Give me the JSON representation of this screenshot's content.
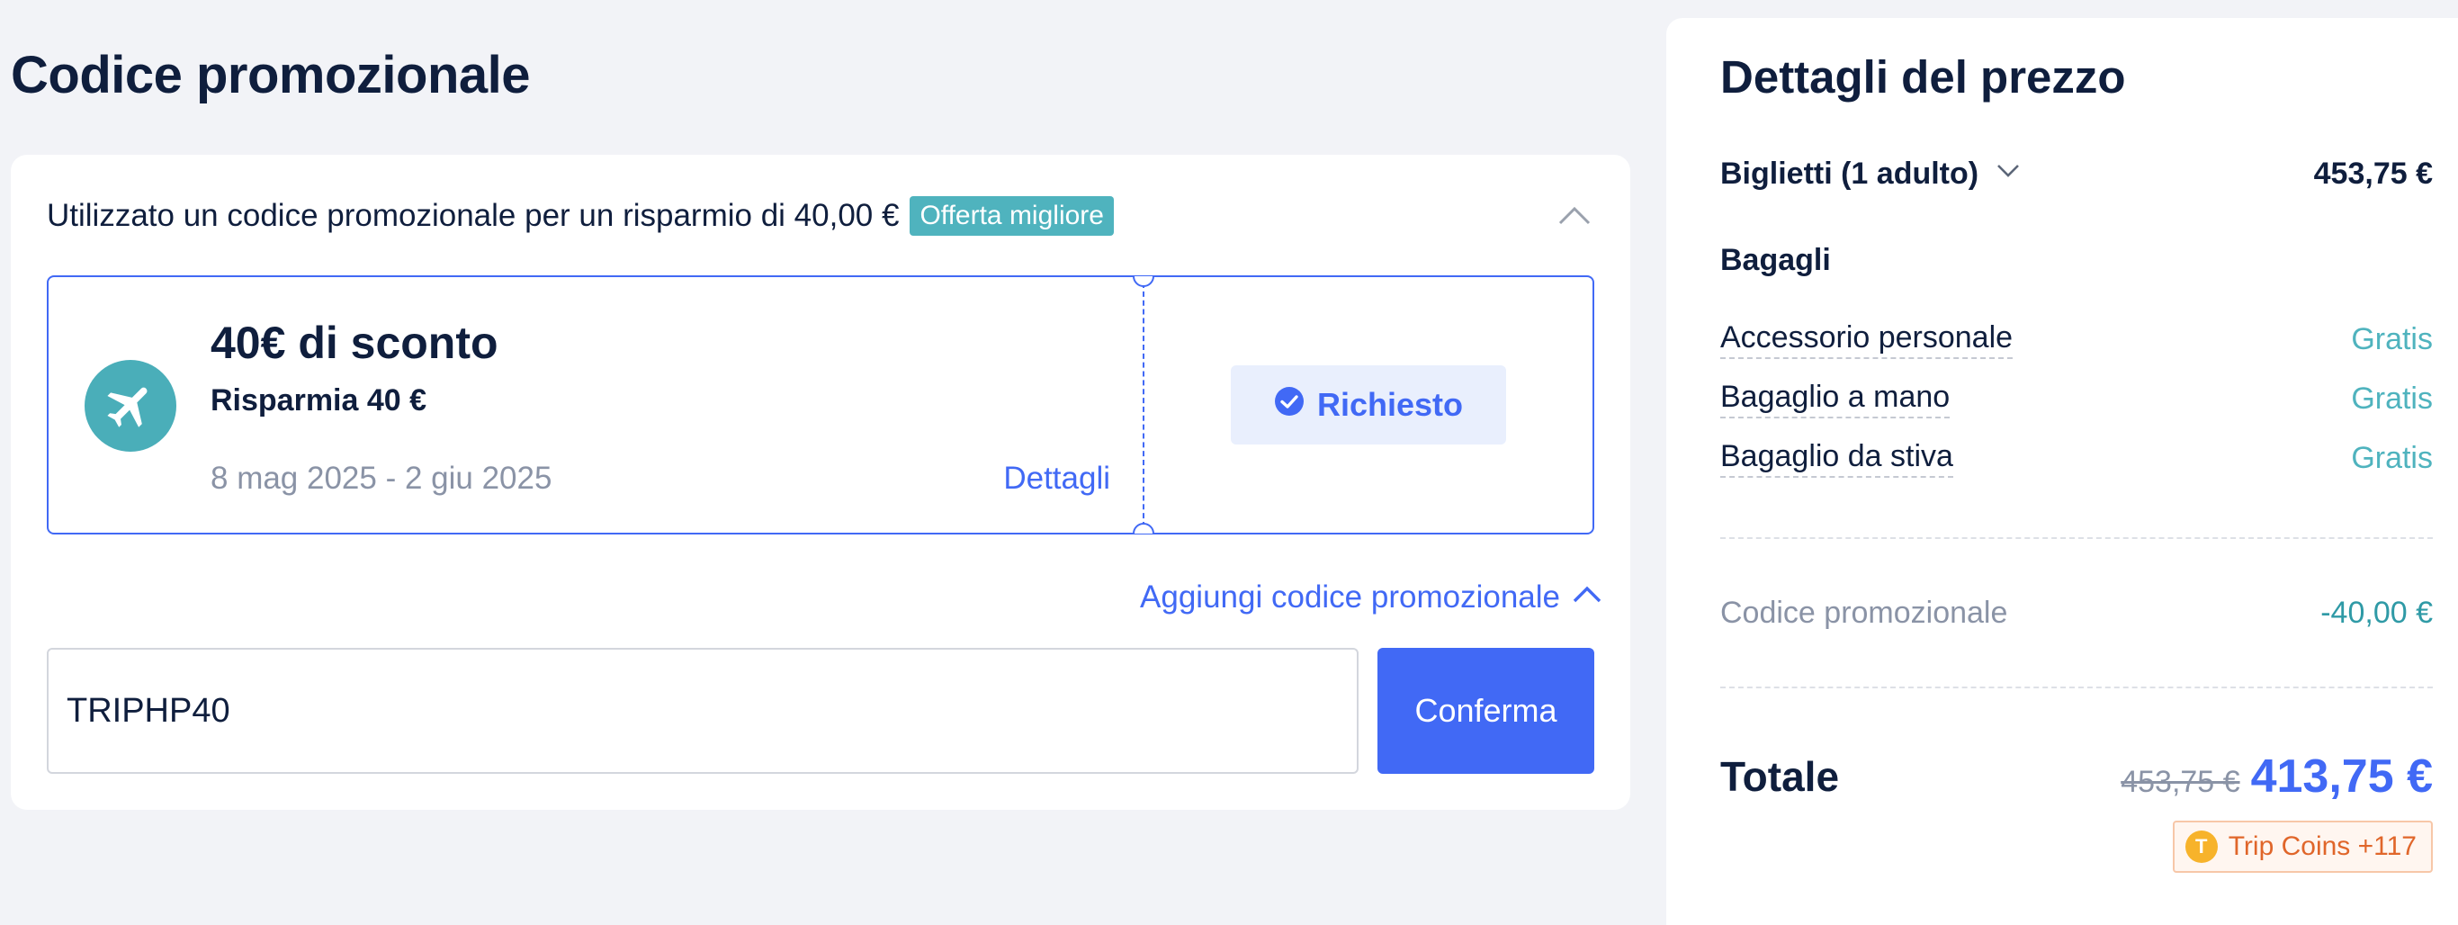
{
  "promo_section": {
    "title": "Codice promozionale",
    "summary_text": "Utilizzato un codice promozionale per un risparmio di 40,00 €",
    "best_offer_badge": "Offerta migliore",
    "coupon": {
      "title": "40€ di sconto",
      "subtitle": "Risparmia 40 €",
      "dates": "8 mag 2025 - 2 giu 2025",
      "details_link": "Dettagli",
      "applied_label": "Richiesto"
    },
    "add_code_link": "Aggiungi codice promozionale",
    "code_input": {
      "value": "TRIPHP40",
      "placeholder": ""
    },
    "confirm_button": "Conferma"
  },
  "price_details": {
    "title": "Dettagli del prezzo",
    "tickets_label": "Biglietti (1 adulto)",
    "tickets_value": "453,75 €",
    "baggage_heading": "Bagagli",
    "baggage_items": [
      {
        "label": "Accessorio personale",
        "value": "Gratis"
      },
      {
        "label": "Bagaglio a mano",
        "value": "Gratis"
      },
      {
        "label": "Bagaglio da stiva",
        "value": "Gratis"
      }
    ],
    "promo_label": "Codice promozionale",
    "promo_value": "-40,00 €",
    "total_label": "Totale",
    "total_old": "453,75 €",
    "total_new": "413,75 €",
    "coins_badge": "Trip Coins +117",
    "coin_symbol": "T"
  },
  "colors": {
    "accent": "#4169f5",
    "teal": "#4fb3be",
    "text": "#0f1e3d",
    "muted": "#8a93a6",
    "coins": "#e0662a"
  },
  "icons": [
    "chevron-up-icon",
    "airplane-icon",
    "check-circle-icon",
    "chevron-down-icon",
    "coin-icon"
  ]
}
